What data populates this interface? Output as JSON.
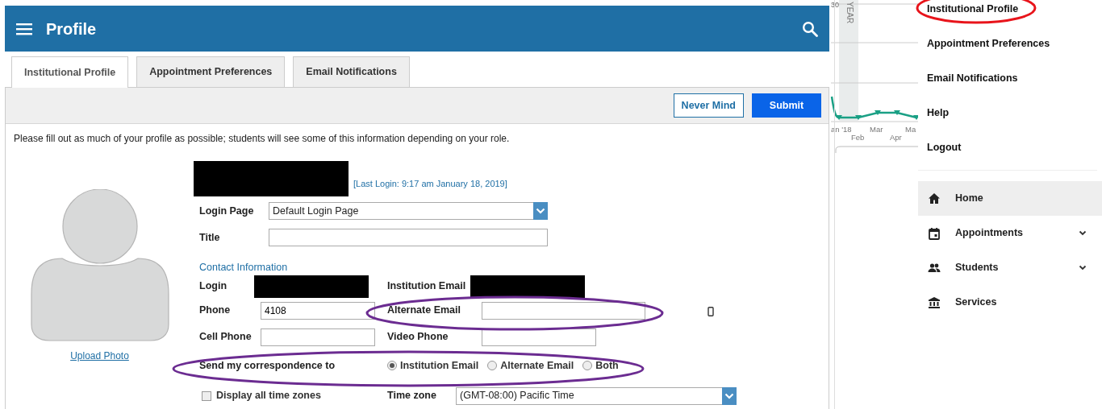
{
  "header": {
    "title": "Profile"
  },
  "tabs": [
    {
      "label": "Institutional Profile",
      "selected": true
    },
    {
      "label": "Appointment Preferences",
      "selected": false
    },
    {
      "label": "Email Notifications",
      "selected": false
    }
  ],
  "toolbar": {
    "buttons": [
      {
        "label": "Never Mind",
        "kind": "outline"
      },
      {
        "label": "Submit",
        "kind": "primary"
      }
    ]
  },
  "intro": "Please fill out as much of your profile as possible; students will see some of this information depending on your role.",
  "photo": {
    "link": "Upload Photo"
  },
  "user": {
    "name_redacted": true,
    "last_login": "[Last Login: 9:17 am January 18, 2019]"
  },
  "login_page": {
    "label": "Login Page",
    "value": "Default Login Page"
  },
  "title_field": {
    "label": "Title"
  },
  "contact": {
    "heading": "Contact Information",
    "login": {
      "label": "Login",
      "redacted": true
    },
    "institution_email": {
      "label": "Institution Email",
      "redacted": true
    },
    "phone": {
      "label": "Phone",
      "value": "4108"
    },
    "alternate_email": {
      "label": "Alternate Email"
    },
    "cell_phone": {
      "label": "Cell Phone"
    },
    "video_phone": {
      "label": "Video Phone"
    }
  },
  "correspondence": {
    "label": "Send my correspondence to",
    "options": [
      {
        "label": "Institution Email",
        "selected": true
      },
      {
        "label": "Alternate Email",
        "selected": false
      },
      {
        "label": "Both",
        "selected": false
      }
    ]
  },
  "time_zones": {
    "checkbox_label": "Display all time zones",
    "checked": false,
    "label": "Time zone",
    "value": "(GMT-08:00) Pacific Time"
  },
  "chart_fragment": {
    "tick": "30",
    "band_label": "YEAR",
    "month_labels": [
      "an '18",
      "Feb",
      "Mar",
      "Apr",
      "Ma"
    ]
  },
  "user_menu": [
    {
      "label": "Institutional Profile"
    },
    {
      "label": "Appointment Preferences"
    },
    {
      "label": "Email Notifications"
    },
    {
      "label": "Help"
    },
    {
      "label": "Logout"
    }
  ],
  "nav": [
    {
      "label": "Home",
      "kind": "home",
      "selected": true,
      "expandable": false
    },
    {
      "label": "Appointments",
      "kind": "calendar",
      "selected": false,
      "expandable": true
    },
    {
      "label": "Students",
      "kind": "people",
      "selected": false,
      "expandable": true
    },
    {
      "label": "Services",
      "kind": "bank",
      "selected": false,
      "expandable": false
    }
  ],
  "annotations": [
    {
      "color": "#e8141b"
    },
    {
      "color": "#6b2c91"
    },
    {
      "color": "#6b2c91"
    }
  ]
}
